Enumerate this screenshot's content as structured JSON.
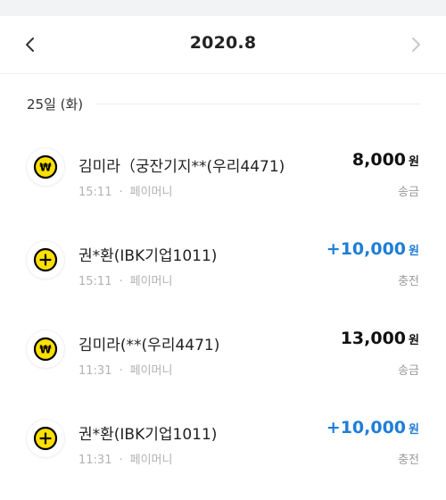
{
  "header": {
    "title": "2020.8",
    "prev_icon": "chevron-left-icon",
    "next_icon": "chevron-right-icon"
  },
  "date_group": {
    "label": "25일 (화)"
  },
  "transactions": [
    {
      "name": "김미라（궁잔기지**(우리4471)",
      "time": "15:11",
      "separator": "·",
      "method": "페이머니",
      "amount": "8,000",
      "unit": "원",
      "type": "송금",
      "icon": "won-coin-icon",
      "direction": "out"
    },
    {
      "name": "권*환(IBK기업1011)",
      "time": "15:11",
      "separator": "·",
      "method": "페이머니",
      "amount": "+10,000",
      "unit": "원",
      "type": "충전",
      "icon": "plus-coin-icon",
      "direction": "in"
    },
    {
      "name": "김미라(**(우리4471)",
      "time": "11:31",
      "separator": "·",
      "method": "페이머니",
      "amount": "13,000",
      "unit": "원",
      "type": "송금",
      "icon": "won-coin-icon",
      "direction": "out"
    },
    {
      "name": "권*환(IBK기업1011)",
      "time": "11:31",
      "separator": "·",
      "method": "페이머니",
      "amount": "+10,000",
      "unit": "원",
      "type": "충전",
      "icon": "plus-coin-icon",
      "direction": "in"
    }
  ],
  "colors": {
    "income": "#1f7ed6",
    "expense": "#111111",
    "coin_fill": "#ffe000",
    "coin_border": "#000000"
  }
}
